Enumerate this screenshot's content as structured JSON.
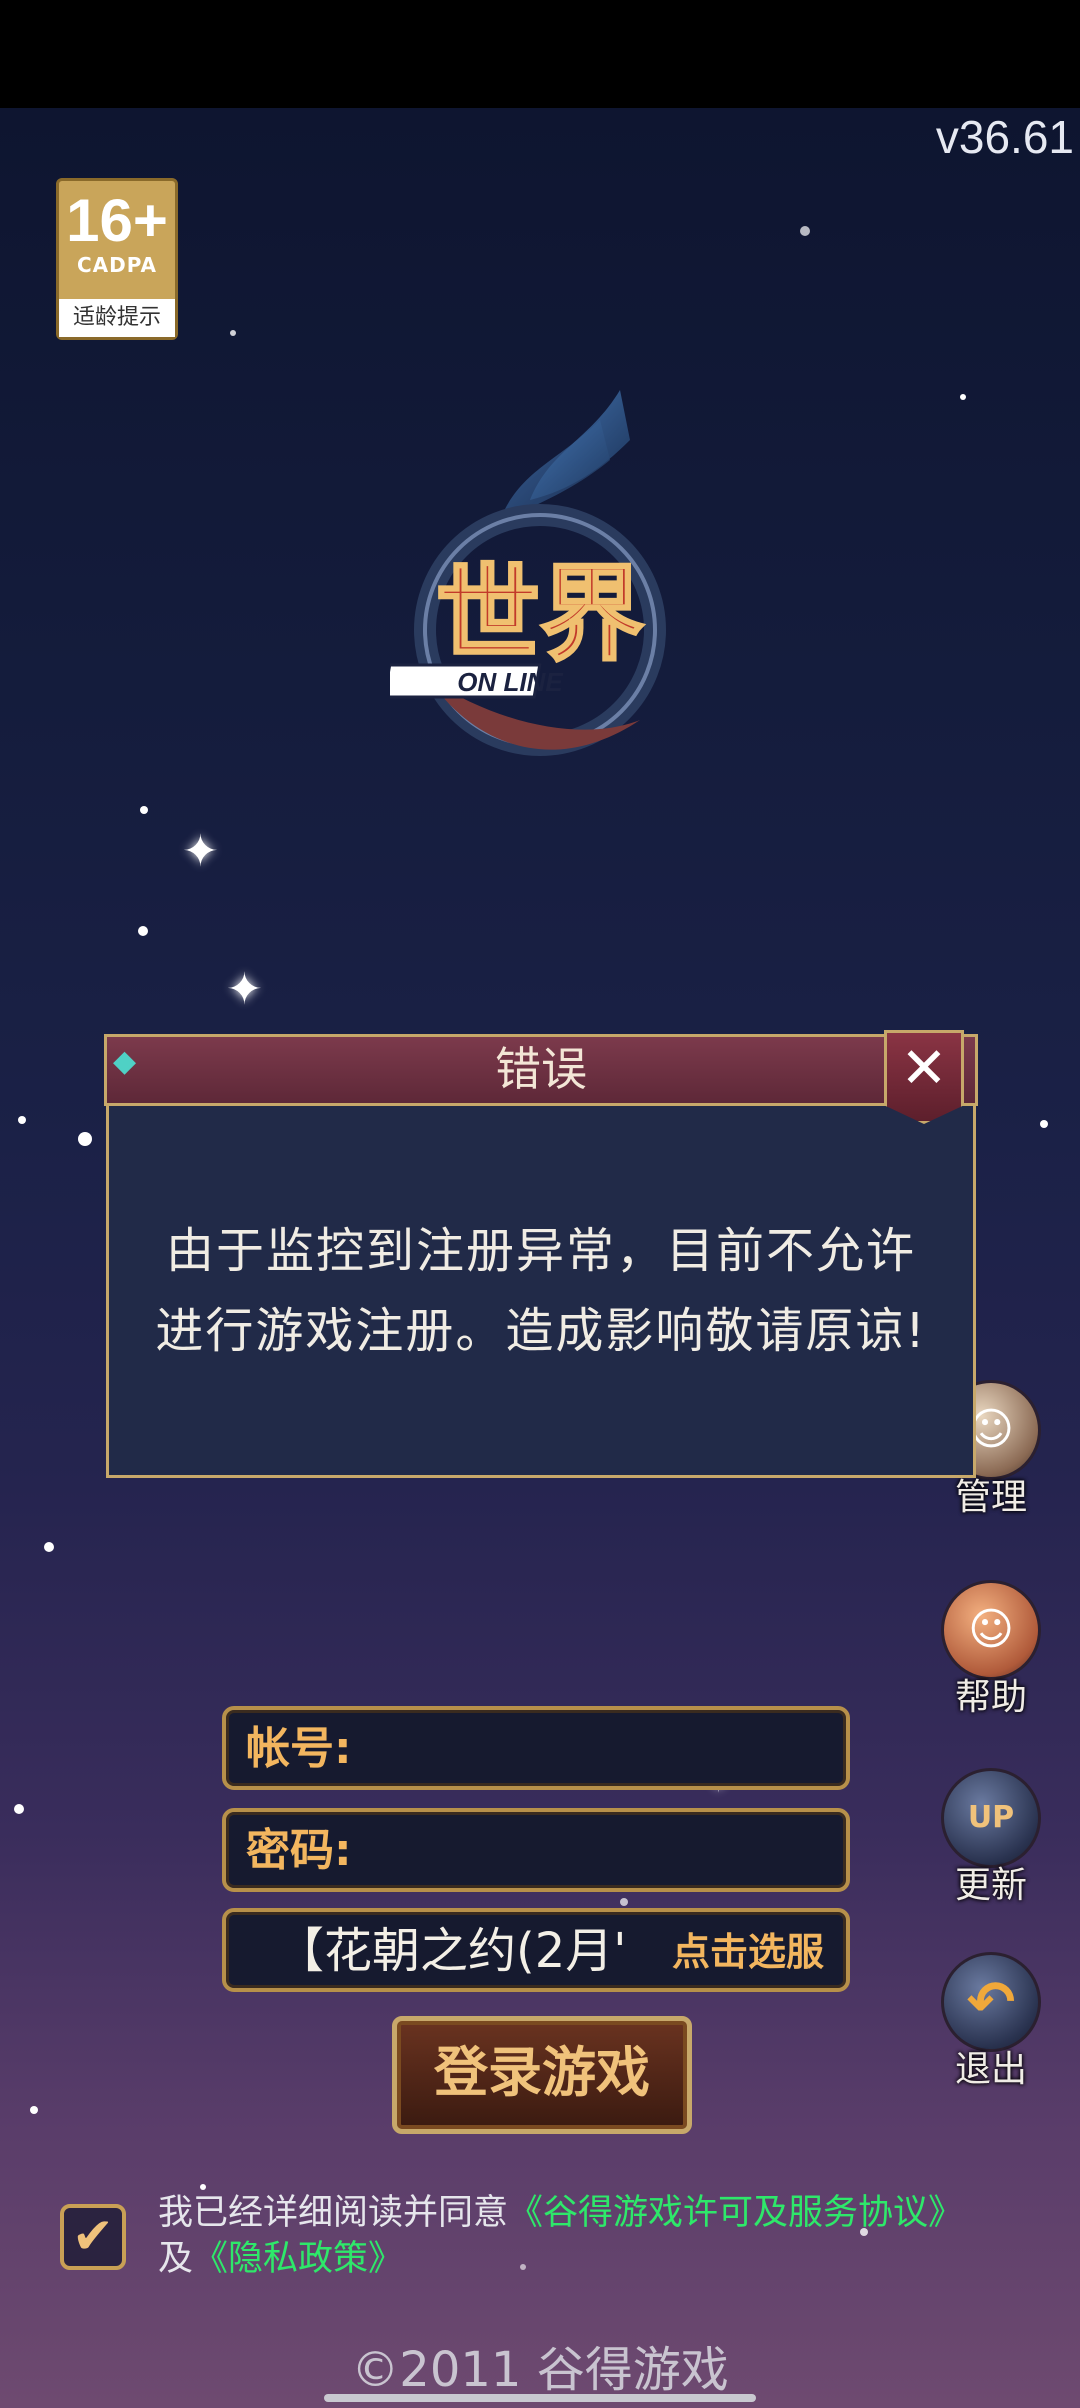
{
  "app": {
    "version": "v36.61",
    "age_rating": {
      "number": "16+",
      "org": "CADPA",
      "tip": "适龄提示"
    },
    "logo": {
      "title": "世界",
      "subtitle": "ON LINE"
    }
  },
  "dialog": {
    "title": "错误",
    "message": "由于监控到注册异常，目前不允许进行游戏注册。造成影响敬请原谅!",
    "close_icon": "close-icon"
  },
  "side_menu": [
    {
      "label": "管理",
      "icon": "manager-icon"
    },
    {
      "label": "帮助",
      "icon": "help-icon"
    },
    {
      "label": "更新",
      "icon": "update-icon",
      "badge": "UP"
    },
    {
      "label": "退出",
      "icon": "exit-icon"
    }
  ],
  "login": {
    "account_label": "帐号:",
    "account_value": "",
    "password_label": "密码:",
    "password_value": "",
    "server_name": "【花朝之约(2月'",
    "server_select_label": "点击选服",
    "login_button": "登录游戏"
  },
  "agreement": {
    "checked": true,
    "text_prefix": "我已经详细阅读并同意",
    "terms_link": "《谷得游戏许可及服务协议》",
    "and": "及",
    "privacy_link": "《隐私政策》"
  },
  "footer": {
    "copyright": "©2011 谷得游戏"
  },
  "colors": {
    "accent_gold": "#c7a86a",
    "link_green": "#2ee86a",
    "dialog_header": "#7c3a4c"
  }
}
